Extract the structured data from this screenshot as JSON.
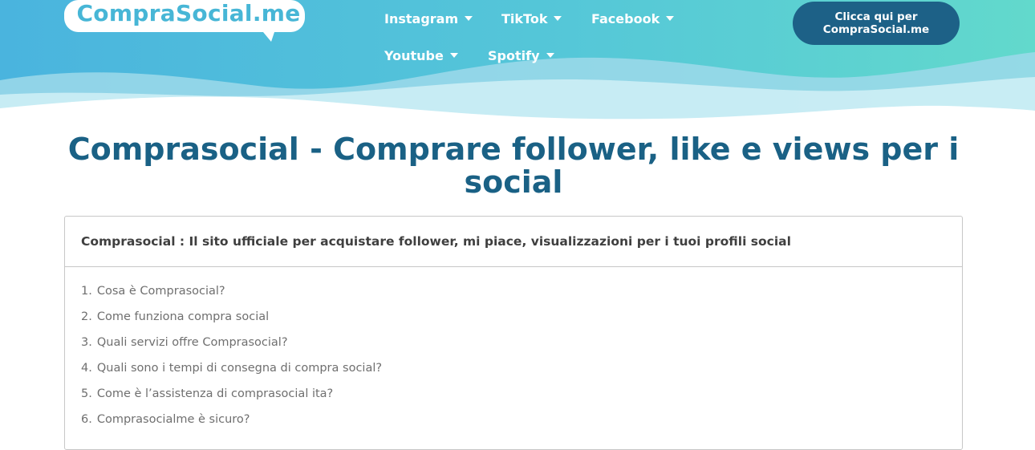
{
  "logo": {
    "text": "CompraSocial.me"
  },
  "nav": {
    "items": [
      {
        "label": "Instagram"
      },
      {
        "label": "TikTok"
      },
      {
        "label": "Facebook"
      },
      {
        "label": "Youtube"
      },
      {
        "label": "Spotify"
      }
    ]
  },
  "cta": {
    "line1": "Clicca qui per",
    "line2": "CompraSocial.me"
  },
  "page": {
    "title": "Comprasocial - Comprare follower, like e views per i social"
  },
  "toc": {
    "header": "Comprasocial : Il sito ufficiale per acquistare follower, mi piace, visualizzazioni per i tuoi profili social",
    "items": [
      {
        "num": "1.",
        "text": "Cosa è Comprasocial?"
      },
      {
        "num": "2.",
        "text": "Come funziona compra social"
      },
      {
        "num": "3.",
        "text": "Quali servizi offre Comprasocial?"
      },
      {
        "num": "4.",
        "text": "Quali sono i tempi di consegna di compra social?"
      },
      {
        "num": "5.",
        "text": "Come è l’assistenza di comprasocial ita?"
      },
      {
        "num": "6.",
        "text": "Comprasocialme è sicuro?"
      }
    ]
  },
  "colors": {
    "header_gradient_start": "#4cb5dd",
    "header_gradient_end": "#5fd8cc",
    "cta_bg": "#1d6187",
    "title": "#1a6185",
    "logo_text": "#47b6d6"
  }
}
